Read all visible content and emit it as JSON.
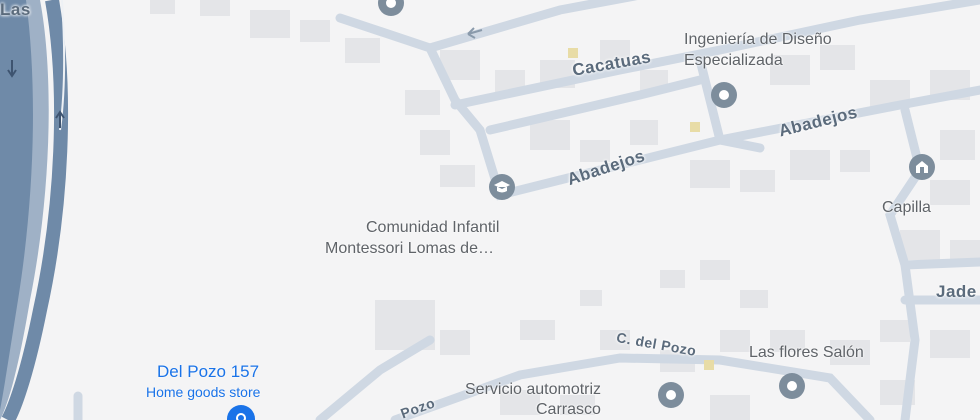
{
  "map": {
    "streets": {
      "cacatuas": "Cacatuas",
      "abadejos_1": "Abadejos",
      "abadejos_2": "Abadejos",
      "jade": "Jade",
      "del_pozo": "C. del Pozo",
      "pozo_short": "Pozo",
      "corner_fragment": "Las"
    },
    "places": [
      {
        "name_lines": [
          "Ingeniería de Diseño",
          "Especializada"
        ],
        "icon": "map-pin-icon"
      },
      {
        "name_lines": [
          "Comunidad Infantil",
          "Montessori Lomas de…"
        ],
        "icon": "school-icon"
      },
      {
        "name_lines": [
          "Capilla"
        ],
        "icon": "church-icon"
      },
      {
        "name_lines": [
          "Las flores Salón"
        ],
        "icon": "map-pin-icon"
      },
      {
        "name_lines": [
          "Servicio automotriz",
          "Carrasco"
        ],
        "icon": "map-pin-icon"
      }
    ],
    "selected_place": {
      "name": "Del Pozo 157",
      "category": "Home goods store",
      "icon": "store-pin-icon"
    },
    "colors": {
      "background": "#f4f4f5",
      "road": "#cfd8e3",
      "highway": "#6f8aa8",
      "building": "#e4e5e8",
      "pin": "#7d8d9c",
      "selected": "#1a73e8"
    }
  }
}
